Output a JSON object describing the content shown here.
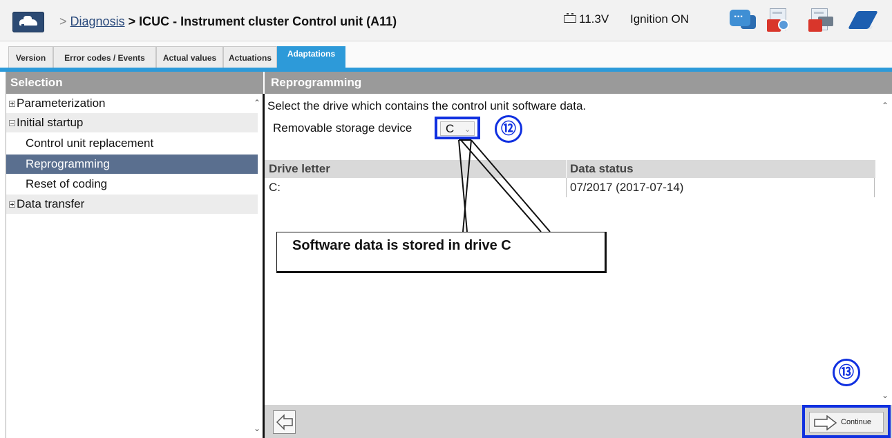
{
  "header": {
    "breadcrumb_sep1": ">",
    "breadcrumb_link": "Diagnosis",
    "breadcrumb_sep2": ">",
    "breadcrumb_current": "ICUC - Instrument cluster Control unit (A11)",
    "battery_voltage": "11.3V",
    "ignition_status": "Ignition ON",
    "icons": [
      "car-icon",
      "chat-icon",
      "pdf-report-icon",
      "pdf-print-icon",
      "manual-book-icon"
    ]
  },
  "tabs": [
    {
      "label": "Version",
      "active": false
    },
    {
      "label": "Error codes / Events",
      "active": false
    },
    {
      "label": "Actual values",
      "active": false
    },
    {
      "label": "Actuations",
      "active": false
    },
    {
      "label": "Adaptations",
      "active": true
    }
  ],
  "selection": {
    "title": "Selection",
    "items": [
      {
        "label": "Parameterization",
        "level": 0,
        "expander": "plus"
      },
      {
        "label": "Initial startup",
        "level": 0,
        "expander": "minus"
      },
      {
        "label": "Control unit replacement",
        "level": 1
      },
      {
        "label": "Reprogramming",
        "level": 1,
        "selected": true
      },
      {
        "label": "Reset of coding",
        "level": 1
      },
      {
        "label": "Data transfer",
        "level": 0,
        "expander": "plus"
      }
    ]
  },
  "main": {
    "title": "Reprogramming",
    "instruction": "Select the drive which contains the control unit software data.",
    "storage_label": "Removable storage device",
    "storage_value": "C",
    "table": {
      "columns": [
        "Drive letter",
        "Data status"
      ],
      "rows": [
        [
          "C:",
          "07/2017 (2017-07-14)"
        ]
      ]
    },
    "continue_label": "Continue"
  },
  "annotations": {
    "callout_12": "⑫",
    "callout_13": "⑬",
    "note": "Software data is stored in drive C"
  },
  "colors": {
    "accent_tab": "#2d9ad9",
    "panel_header": "#9a9a9a",
    "selected_item": "#5a6f8f",
    "annotation_blue": "#1030e0"
  }
}
